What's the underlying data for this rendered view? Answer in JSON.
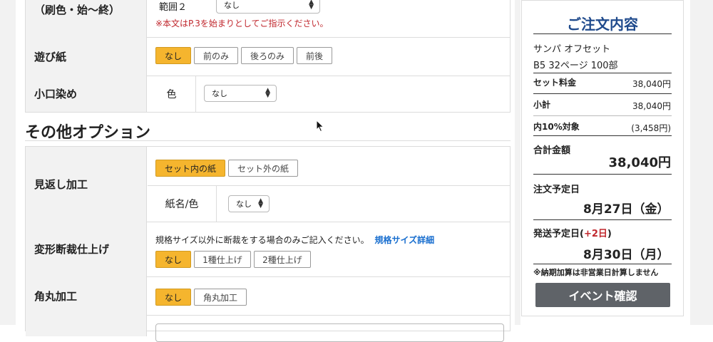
{
  "table1": {
    "row_range_label": "（刷色・始〜終）",
    "range2_label": "範囲２",
    "range2_value": "なし",
    "note": "※本文はP.3を始まりとしてご指示ください。",
    "asobi_label": "遊び紙",
    "asobi_options": [
      "なし",
      "前のみ",
      "後ろのみ",
      "前後"
    ],
    "koguchi_label": "小口染め",
    "koguchi_color_label": "色",
    "koguchi_color_value": "なし"
  },
  "section_heading": "その他オプション",
  "table2": {
    "mikaeshi_label": "見返し加工",
    "mikaeshi_options": [
      "セット内の紙",
      "セット外の紙"
    ],
    "mikaeshi_paper_label": "紙名/色",
    "mikaeshi_paper_value": "なし",
    "henkei_label": "変形断裁仕上げ",
    "henkei_note": "規格サイズ以外に断裁をする場合のみご記入ください。",
    "henkei_link": "規格サイズ詳細",
    "henkei_options": [
      "なし",
      "1種仕上げ",
      "2種仕上げ"
    ],
    "kadomaru_label": "角丸加工",
    "kadomaru_options": [
      "なし",
      "角丸加工"
    ]
  },
  "order_panel": {
    "title": "ご注文内容",
    "product_line1": "サンパ オフセット",
    "product_line2": "B5  32ページ  100部",
    "set_price_label": "セット料金",
    "set_price_value": "38,040円",
    "subtotal_label": "小計",
    "subtotal_value": "38,040円",
    "tax_label": "内10%対象",
    "tax_value": "(3,458円)",
    "total_label": "合計金額",
    "total_value": "38,040円",
    "order_date_label": "注文予定日",
    "order_date_value": "8月27日（金）",
    "ship_date_label_prefix": "発送予定日(",
    "ship_date_plus": "+2日",
    "ship_date_label_suffix": ")",
    "ship_date_value": "8月30日（月）",
    "ship_note": "※納期加算は非営業日計算しません",
    "confirm_button": "イベント確認"
  },
  "colors": {
    "selected": "#f5b52e",
    "panel_title": "#1f4a8c",
    "note_red": "#c0272d",
    "link_blue": "#1a6fcf",
    "confirm_bg": "#5f6368"
  }
}
